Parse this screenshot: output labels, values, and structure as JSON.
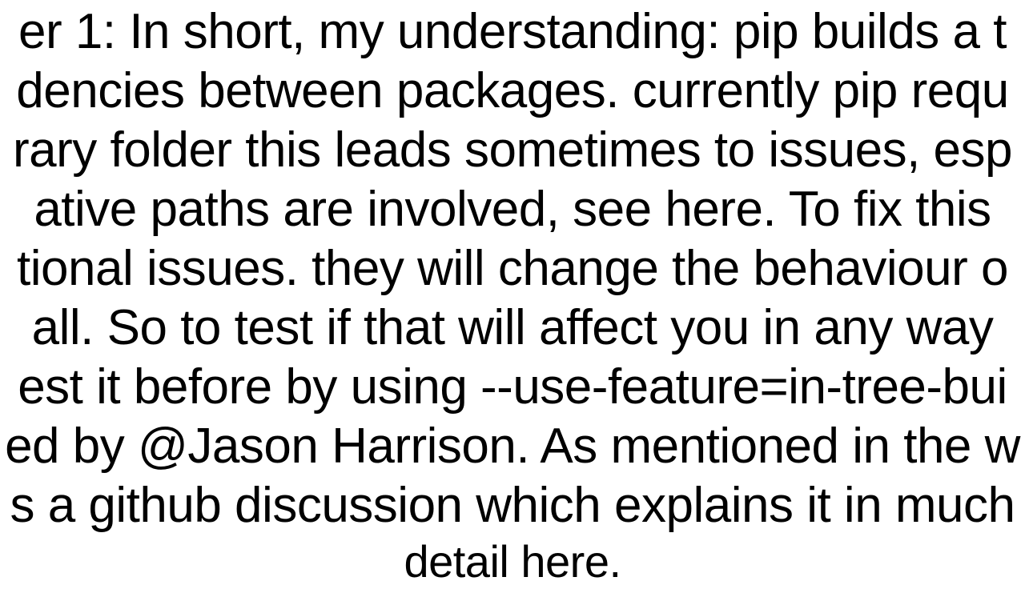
{
  "text": {
    "l1": "er 1: In short, my understanding:  pip builds a t",
    "l2": "dencies between packages. currently pip requ",
    "l3": "rary folder this leads sometimes to issues, esp",
    "l4": "ative paths are involved, see here.  To fix this",
    "l5": "tional issues. they will change the behaviour o",
    "l6": "all. So to test if that will affect you in any way ",
    "l7": "est it before by using --use-feature=in-tree-bui",
    "l8": "ed by @Jason Harrison. As mentioned in the w",
    "l9": "s a github discussion which explains it in much",
    "l10": "detail here."
  }
}
